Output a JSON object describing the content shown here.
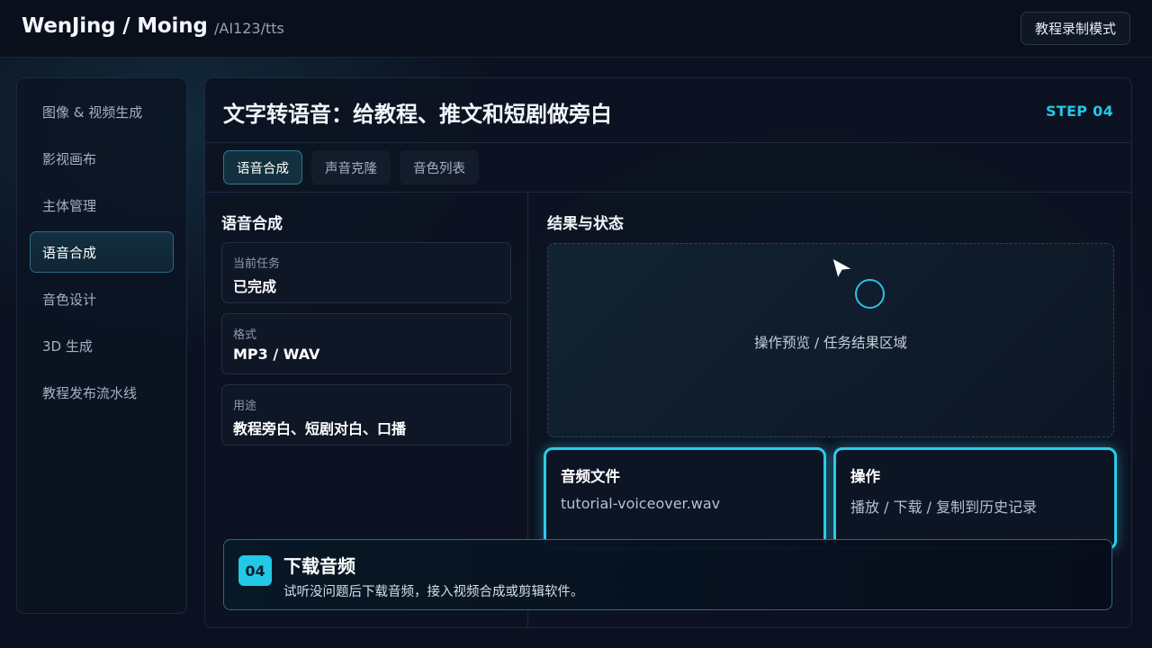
{
  "header": {
    "brand": "WenJing / Moing",
    "path": "/AI123/tts",
    "record_mode_button": "教程录制模式"
  },
  "sidebar": {
    "items": [
      {
        "label": "图像 & 视频生成",
        "active": false
      },
      {
        "label": "影视画布",
        "active": false
      },
      {
        "label": "主体管理",
        "active": false
      },
      {
        "label": "语音合成",
        "active": true
      },
      {
        "label": "音色设计",
        "active": false
      },
      {
        "label": "3D 生成",
        "active": false
      },
      {
        "label": "教程发布流水线",
        "active": false
      }
    ]
  },
  "main": {
    "title": "文字转语音：给教程、推文和短剧做旁白",
    "step": "STEP 04",
    "tabs": [
      {
        "label": "语音合成",
        "active": true
      },
      {
        "label": "声音克隆",
        "active": false
      },
      {
        "label": "音色列表",
        "active": false
      }
    ],
    "left_section_title": "语音合成",
    "info_cards": [
      {
        "label": "当前任务",
        "value": "已完成"
      },
      {
        "label": "格式",
        "value": "MP3 / WAV"
      },
      {
        "label": "用途",
        "value": "教程旁白、短剧对白、口播"
      }
    ],
    "right_section_title": "结果与状态",
    "preview_text": "操作预览 / 任务结果区域",
    "result_cards": [
      {
        "title": "音频文件",
        "value": "tutorial-voiceover.wav"
      },
      {
        "title": "操作",
        "value": "播放 / 下载 / 复制到历史记录"
      }
    ]
  },
  "toast": {
    "number": "04",
    "title": "下载音频",
    "description": "试听没问题后下载音频，接入视频合成或剪辑软件。"
  },
  "colors": {
    "accent": "#22c8e6",
    "background": "#0b1120",
    "panel": "#0c1321"
  }
}
